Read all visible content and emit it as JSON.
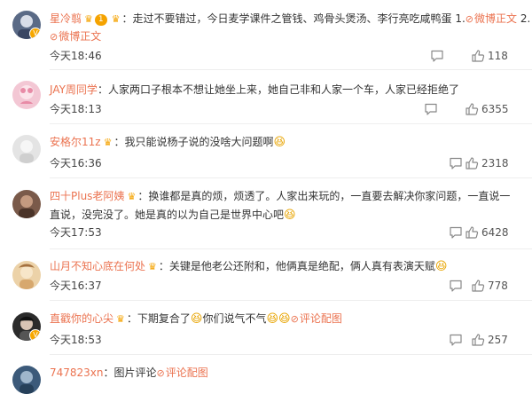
{
  "comments": [
    {
      "name": "星冷翦",
      "vip_badge": "1",
      "text": "：走过不要错过，今日麦学课件之管钱、鸡骨头煲汤、李行亮吃咸鸭蛋 1.",
      "link1": "微博正文",
      "trail": " 2.",
      "link2": "微博正文",
      "time": "今天18:46",
      "likes": "118"
    },
    {
      "name": "JAY周同学",
      "text": "：人家两口子根本不想让她坐上来，她自己非和人家一个车，人家已经拒绝了",
      "time": "今天18:13",
      "likes": "6355"
    },
    {
      "name": "安格尔11z",
      "text": "：我只能说杨子说的没啥大问题啊",
      "time": "今天16:36",
      "likes": "2318"
    },
    {
      "name": "四十Plus老阿姨",
      "text": "：换谁都是真的烦，烦透了。人家出来玩的，一直要去解决你家问题，一直说一直说，没完没了。她是真的以为自己是世界中心吧",
      "time": "今天17:53",
      "likes": "6428"
    },
    {
      "name": "山月不知心底在何处",
      "text": "：关键是他老公还附和，他俩真是绝配，俩人真有表演天赋",
      "time": "今天16:37",
      "likes": "778"
    },
    {
      "name": "直戳你的心尖",
      "text": "：下期复合了",
      "text2": "你们说气不气",
      "link1": "评论配图",
      "time": "今天18:53",
      "likes": "257"
    },
    {
      "name": "747823xn",
      "text": "：图片评论",
      "link1": "评论配图"
    }
  ],
  "colors": {
    "name": "#eb7350",
    "link": "#eb7350",
    "icon": "#888888",
    "divider": "#eeeeee"
  },
  "icons": {
    "reply": "comment-icon",
    "like": "thumbs-up-icon",
    "vip": "crown-icon",
    "link": "weibo-link-icon",
    "emoji": "laughing-emoji-icon"
  }
}
